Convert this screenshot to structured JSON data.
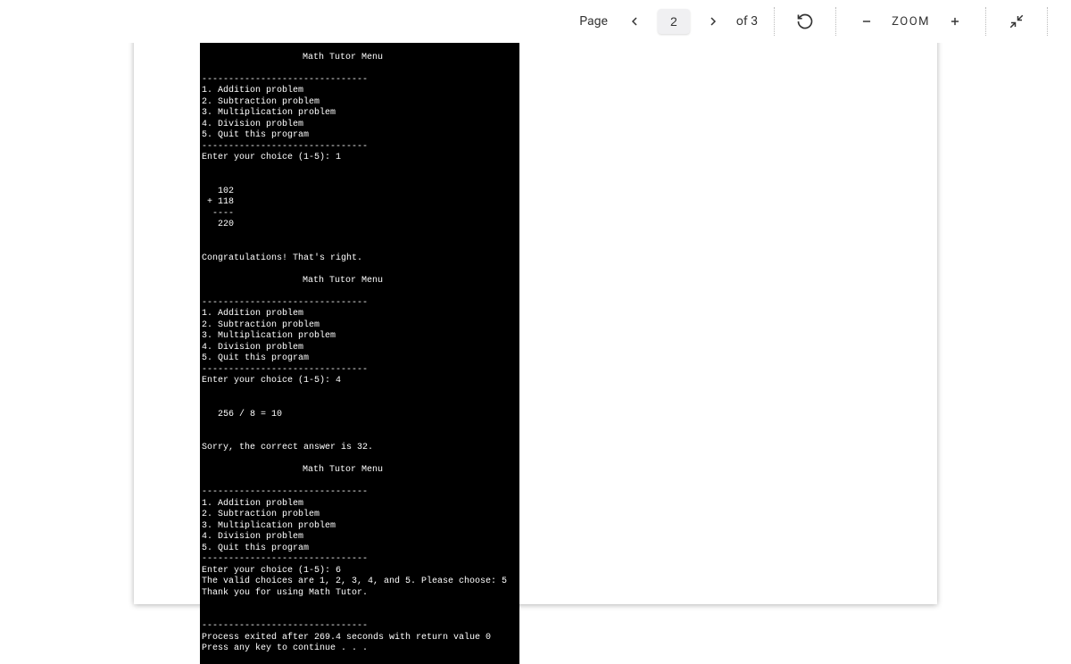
{
  "toolbar": {
    "page_label": "Page",
    "current_page": "2",
    "of_text": "of 3",
    "zoom_label": "ZOOM"
  },
  "console": {
    "menu_title": "Math Tutor Menu",
    "divider": "-------------------------------",
    "menu_items": [
      "1. Addition problem",
      "2. Subtraction problem",
      "3. Multiplication problem",
      "4. Division problem",
      "5. Quit this program"
    ],
    "prompt1": "Enter your choice (1-5): 1",
    "add_line1": "   102",
    "add_line2": " + 118",
    "add_line3": "  ----",
    "add_line4": "   220",
    "congrats": "Congratulations! That's right.",
    "prompt2": "Enter your choice (1-5): 4",
    "div_line": "   256 / 8 = 10",
    "sorry": "Sorry, the correct answer is 32.",
    "prompt3": "Enter your choice (1-5): 6",
    "valid": "The valid choices are 1, 2, 3, 4, and 5. Please choose: 5",
    "thanks": "Thank you for using Math Tutor.",
    "process": "Process exited after 269.4 seconds with return value 0",
    "press": "Press any key to continue . . ."
  }
}
